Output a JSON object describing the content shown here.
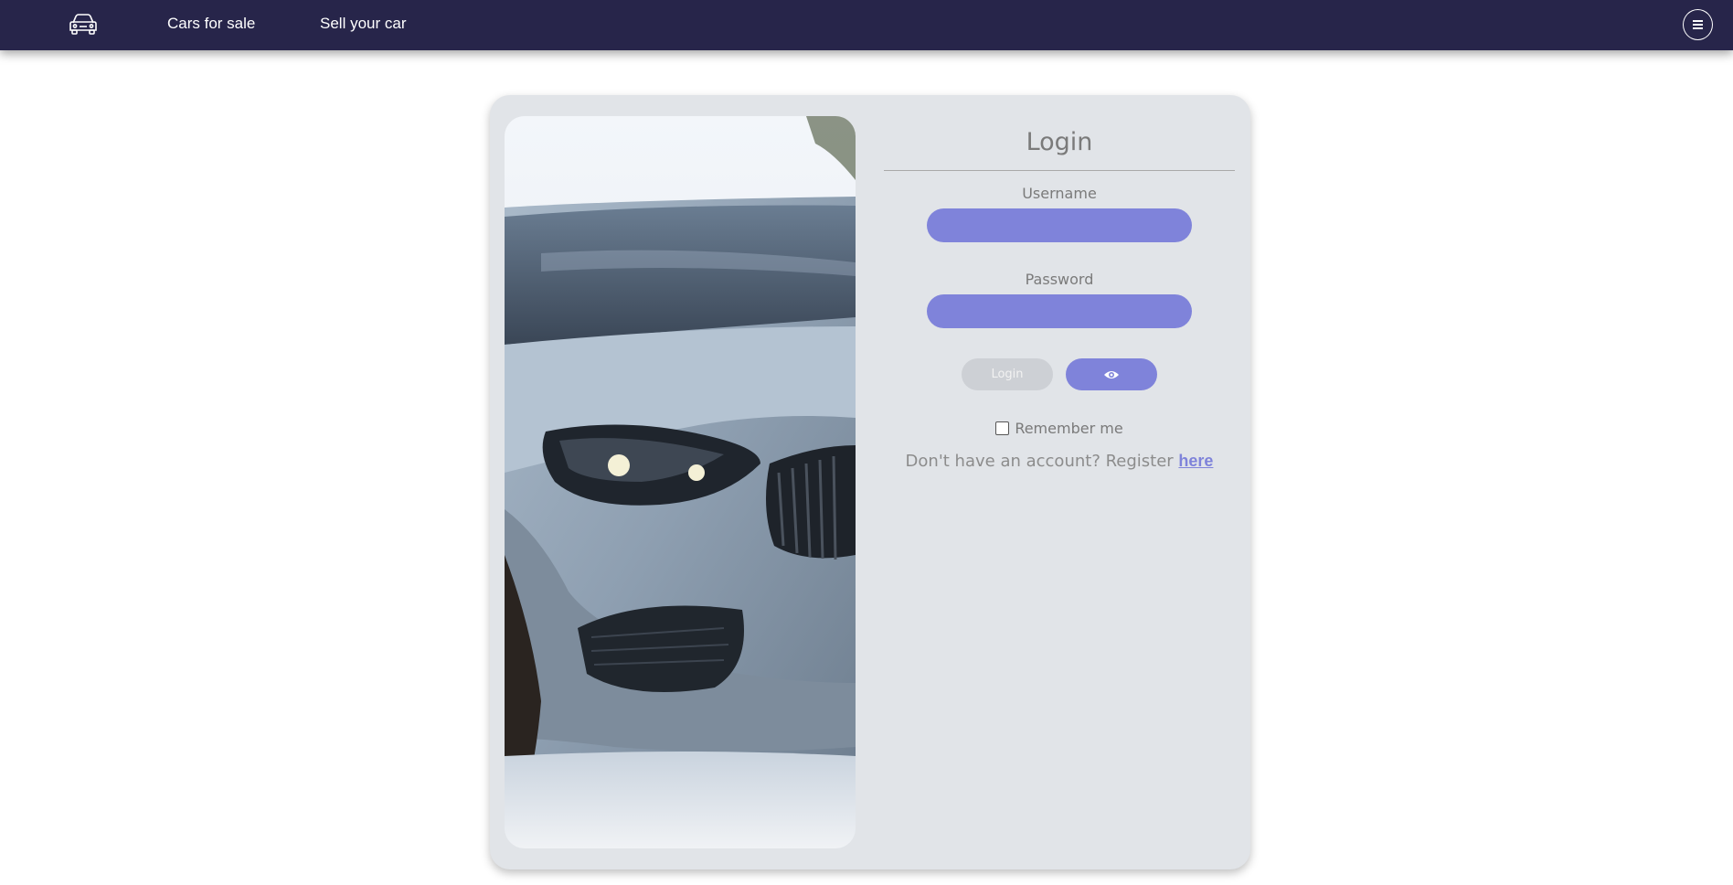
{
  "nav": {
    "logo_icon": "car-icon",
    "links": [
      "Cars for sale",
      "Sell your car"
    ],
    "menu_icon": "hamburger-menu-icon"
  },
  "login": {
    "title": "Login",
    "username_label": "Username",
    "username_value": "",
    "password_label": "Password",
    "password_value": "",
    "login_button": "Login",
    "show_password_icon": "eye-icon",
    "remember_label": "Remember me",
    "remember_checked": false,
    "register_text": "Don't have an account? Register ",
    "register_link": "here"
  },
  "colors": {
    "navbar": "#27254a",
    "accent": "#7f83da",
    "card": "#e1e4e8"
  },
  "image": {
    "subject": "car-photo"
  }
}
